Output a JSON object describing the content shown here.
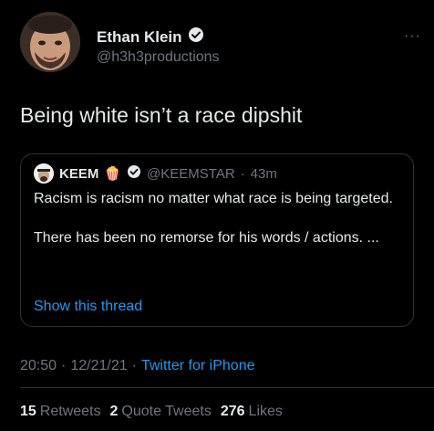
{
  "author": {
    "name": "Ethan Klein",
    "handle": "@h3h3productions"
  },
  "more_label": "···",
  "tweet_text": "Being white isn’t a race dipshit",
  "quoted": {
    "name": "KEEM",
    "emoji": "🍿",
    "handle": "@KEEMSTAR",
    "separator": "·",
    "time": "43m",
    "line1": "Racism is racism no matter what race is being targeted.",
    "line2": "There has been no remorse for his words / actions. ...",
    "show_thread": "Show this thread"
  },
  "meta": {
    "time": "20:50",
    "sep1": "·",
    "date": "12/21/21",
    "sep2": "·",
    "source": "Twitter for iPhone"
  },
  "stats": {
    "retweets_count": "15",
    "retweets_label": "Retweets",
    "quotes_count": "2",
    "quotes_label": "Quote Tweets",
    "likes_count": "276",
    "likes_label": "Likes"
  },
  "colors": {
    "accent": "#1d9bf0",
    "background": "#000000",
    "muted": "#71767b"
  }
}
